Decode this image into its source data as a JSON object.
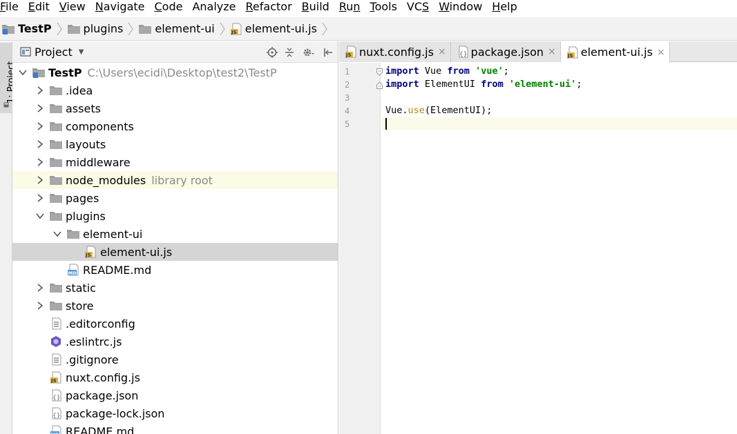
{
  "menu": [
    {
      "m": "F",
      "rest": "ile"
    },
    {
      "m": "E",
      "rest": "dit"
    },
    {
      "m": "V",
      "rest": "iew"
    },
    {
      "m": "N",
      "rest": "avigate"
    },
    {
      "m": "C",
      "rest": "ode"
    },
    {
      "m": "",
      "rest": "Analyze"
    },
    {
      "m": "R",
      "rest": "efactor"
    },
    {
      "m": "B",
      "rest": "uild"
    },
    {
      "m": "R",
      "rest": "u",
      "tail": "n"
    },
    {
      "m": "T",
      "rest": "ools"
    },
    {
      "m": "",
      "rest": "VC",
      "ul_tail": "S"
    },
    {
      "m": "W",
      "rest": "indow"
    },
    {
      "m": "H",
      "rest": "elp"
    }
  ],
  "breadcrumb": [
    "TestP",
    "plugins",
    "element-ui",
    "element-ui.js"
  ],
  "toolstrip": {
    "label": "1: Project"
  },
  "project": {
    "title": "Project",
    "tree": [
      {
        "indent": 0,
        "arrow": "down",
        "icon": "project",
        "label": "TestP",
        "bold": true,
        "extra": "C:\\Users\\ecidi\\Desktop\\test2\\TestP"
      },
      {
        "indent": 1,
        "arrow": "right",
        "icon": "folder",
        "label": ".idea"
      },
      {
        "indent": 1,
        "arrow": "right",
        "icon": "folder",
        "label": "assets"
      },
      {
        "indent": 1,
        "arrow": "right",
        "icon": "folder",
        "label": "components"
      },
      {
        "indent": 1,
        "arrow": "right",
        "icon": "folder",
        "label": "layouts"
      },
      {
        "indent": 1,
        "arrow": "right",
        "icon": "folder",
        "label": "middleware"
      },
      {
        "indent": 1,
        "arrow": "right",
        "icon": "folder",
        "label": "node_modules",
        "extra": "library root",
        "hl": "yellow"
      },
      {
        "indent": 1,
        "arrow": "right",
        "icon": "folder",
        "label": "pages"
      },
      {
        "indent": 1,
        "arrow": "down",
        "icon": "folder",
        "label": "plugins"
      },
      {
        "indent": 2,
        "arrow": "down",
        "icon": "folder",
        "label": "element-ui"
      },
      {
        "indent": 3,
        "arrow": "none",
        "icon": "js",
        "label": "element-ui.js",
        "hl": "sel"
      },
      {
        "indent": 2,
        "arrow": "none",
        "icon": "md",
        "label": "README.md"
      },
      {
        "indent": 1,
        "arrow": "right",
        "icon": "folder",
        "label": "static"
      },
      {
        "indent": 1,
        "arrow": "right",
        "icon": "folder",
        "label": "store"
      },
      {
        "indent": 1,
        "arrow": "none",
        "icon": "text",
        "label": ".editorconfig"
      },
      {
        "indent": 1,
        "arrow": "none",
        "icon": "eslint",
        "label": ".eslintrc.js"
      },
      {
        "indent": 1,
        "arrow": "none",
        "icon": "text",
        "label": ".gitignore"
      },
      {
        "indent": 1,
        "arrow": "none",
        "icon": "js",
        "label": "nuxt.config.js"
      },
      {
        "indent": 1,
        "arrow": "none",
        "icon": "json",
        "label": "package.json"
      },
      {
        "indent": 1,
        "arrow": "none",
        "icon": "json",
        "label": "package-lock.json"
      },
      {
        "indent": 1,
        "arrow": "none",
        "icon": "md",
        "label": "README.md"
      }
    ]
  },
  "editor": {
    "tabs": [
      {
        "icon": "js",
        "label": "nuxt.config.js",
        "close": "×",
        "active": false
      },
      {
        "icon": "json",
        "label": "package.json",
        "close": "×",
        "active": false
      },
      {
        "icon": "js",
        "label": "element-ui.js",
        "close": "×",
        "active": true
      }
    ],
    "line_numbers": [
      "1",
      "2",
      "3",
      "4",
      "5"
    ],
    "code": {
      "l1": {
        "kw1": "import",
        "t1": " Vue ",
        "kw2": "from",
        "t2": " ",
        "s": "'vue'",
        "t3": ";"
      },
      "l2": {
        "kw1": "import",
        "t1": " ElementUI ",
        "kw2": "from",
        "t2": " ",
        "s": "'element-ui'",
        "t3": ";"
      },
      "l4": {
        "t1": "Vue.",
        "fn": "use",
        "t2": "(ElementUI);"
      }
    }
  },
  "colors": {
    "keyword": "#000080",
    "string": "#008000",
    "function": "#b8860b",
    "selection": "#d5d5d5",
    "library_root": "#fbfbe6"
  }
}
